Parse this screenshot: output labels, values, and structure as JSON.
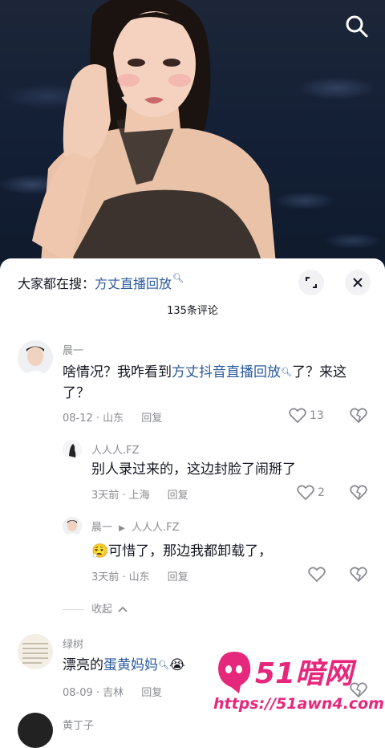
{
  "search_bar": {
    "prefix": "大家都在搜：",
    "keyword": "方丈直播回放"
  },
  "comments_count": "135条评论",
  "comments": [
    {
      "user": "晨一",
      "text_before": "啥情况？我咋看到",
      "keyword": "方丈抖音直播回放",
      "text_after": "了？来这了？",
      "date_loc": "08-12 · 山东",
      "reply": "回复",
      "likes": "13"
    },
    {
      "user": "人人人.FZ",
      "text": "别人录过来的，这边封脸了闹掰了",
      "date_loc": "3天前 · 上海",
      "reply": "回复",
      "likes": "2"
    },
    {
      "user": "晨一",
      "reply_to": "人人人.FZ",
      "emoji": "😮‍💨",
      "text": "可惜了，那边我都卸载了，",
      "date_loc": "3天前 · 山东",
      "reply": "回复"
    },
    {
      "user": "绿树",
      "text_before": "漂亮的",
      "keyword": "蛋黄妈妈",
      "emoji": "😭",
      "date_loc": "08-09 · 吉林",
      "reply": "回复"
    },
    {
      "user": "黄丁子"
    }
  ],
  "collapse_label": "收起",
  "watermark": {
    "brand": "51暗网",
    "url": "https://51awn4.com"
  },
  "colors": {
    "keyword": "#2a5a9b",
    "meta": "#8a8b91",
    "watermark": "#e6287c"
  }
}
